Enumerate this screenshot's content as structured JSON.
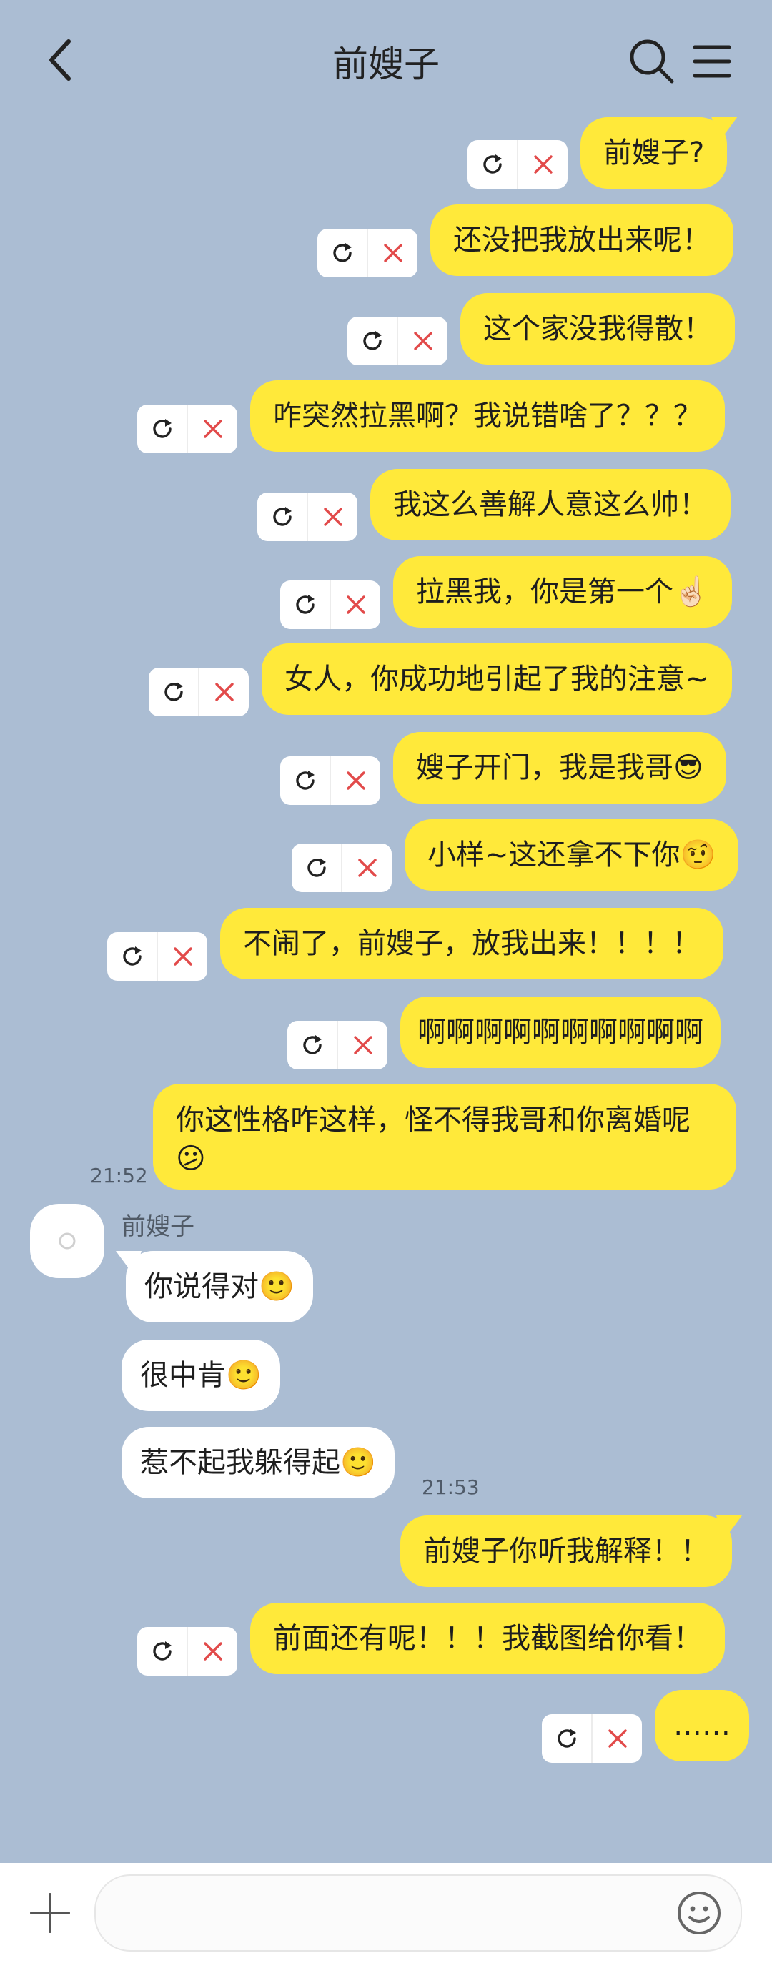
{
  "header": {
    "title": "前嫂子",
    "back_icon": "chevron-left-icon",
    "search_icon": "search-icon",
    "menu_icon": "menu-icon"
  },
  "colors": {
    "background": "#abbdd3",
    "outgoing_bubble": "#ffe93a",
    "incoming_bubble": "#ffffff",
    "error_x": "#e24a4a"
  },
  "messages_out": [
    {
      "text": "前嫂子?"
    },
    {
      "text": "还没把我放出来呢！"
    },
    {
      "text": "这个家没我得散！"
    },
    {
      "text": "咋突然拉黑啊？我说错啥了？？？"
    },
    {
      "text": "我这么善解人意这么帅！"
    },
    {
      "text": "拉黑我，你是第一个☝🏻"
    },
    {
      "text": "女人，你成功地引起了我的注意~"
    },
    {
      "text": "嫂子开门，我是我哥😎"
    },
    {
      "text": "小样~这还拿不下你🤨"
    },
    {
      "text": "不闹了，前嫂子，放我出来！！！！"
    },
    {
      "text": "啊啊啊啊啊啊啊啊啊啊"
    }
  ],
  "message_long": {
    "text": "你这性格咋这样，怪不得我哥和你离婚呢😕"
  },
  "time_1": "21:52",
  "sender_name": "前嫂子",
  "messages_in": [
    {
      "text": "你说得对🙂"
    },
    {
      "text": "很中肯🙂"
    },
    {
      "text": "惹不起我躲得起🙂"
    }
  ],
  "time_2": "21:53",
  "messages_out_2": [
    {
      "text": "前嫂子你听我解释！！"
    },
    {
      "text": "前面还有呢！！！我截图给你看！"
    },
    {
      "text": "……"
    }
  ],
  "resend_actions": {
    "retry_icon": "refresh-icon",
    "delete_icon": "close-icon"
  },
  "input": {
    "placeholder": ""
  },
  "footer": {
    "plus_icon": "plus-icon",
    "emoji_icon": "smiley-icon"
  }
}
